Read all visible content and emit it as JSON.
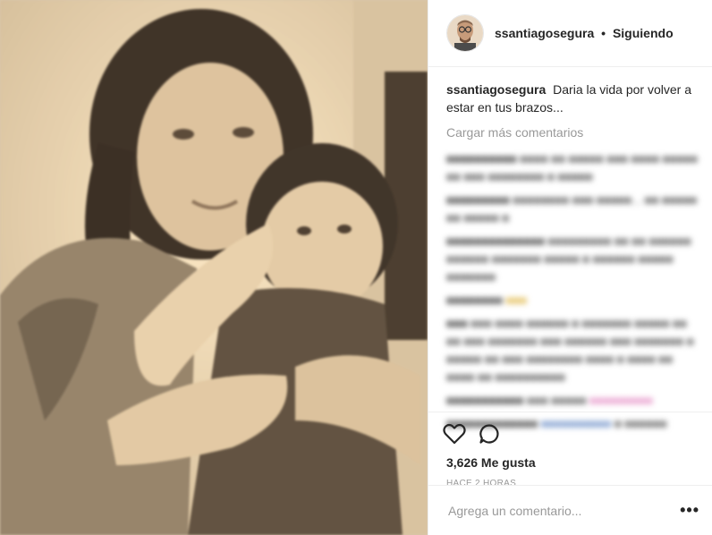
{
  "header": {
    "username": "ssantiagosegura",
    "separator": "•",
    "follow_status": "Siguiendo"
  },
  "caption": {
    "username": "ssantiagosegura",
    "text": "Daria la vida por volver a estar en tus brazos..."
  },
  "load_more": "Cargar más comentarios",
  "likes": "3,626 Me gusta",
  "timestamp": "HACE 2 HORAS",
  "comment_input": {
    "placeholder": "Agrega un comentario..."
  },
  "more_options": "•••",
  "icons": {
    "like": "heart-outline-icon",
    "comment": "speech-bubble-icon",
    "more": "ellipsis-icon"
  },
  "colors": {
    "text": "#262626",
    "secondary": "#999999",
    "border": "#efefef",
    "sepia": "#d9c7ad"
  }
}
